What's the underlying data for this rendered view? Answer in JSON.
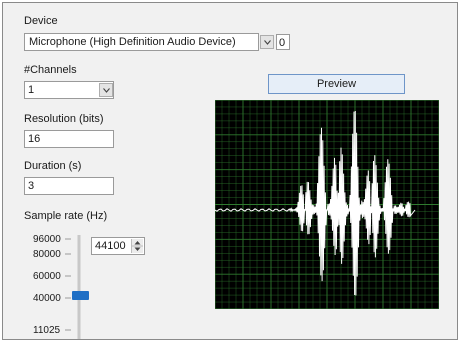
{
  "device": {
    "label": "Device",
    "selected": "Microphone (High Definition Audio Device)",
    "index": "0"
  },
  "channels": {
    "label": "#Channels",
    "selected": "1"
  },
  "resolution": {
    "label": "Resolution (bits)",
    "value": "16"
  },
  "duration": {
    "label": "Duration (s)",
    "value": "3"
  },
  "sample_rate": {
    "label": "Sample rate (Hz)",
    "value": "44100",
    "slider_value": 44100,
    "ticks": [
      "96000",
      "80000",
      "60000",
      "40000",
      "11025"
    ]
  },
  "preview": {
    "label": "Preview"
  },
  "colors": {
    "accent": "#1f6fc5",
    "scope_bg": "#000000",
    "scope_grid": "#2f7a2f",
    "waveform": "#ffffff"
  }
}
